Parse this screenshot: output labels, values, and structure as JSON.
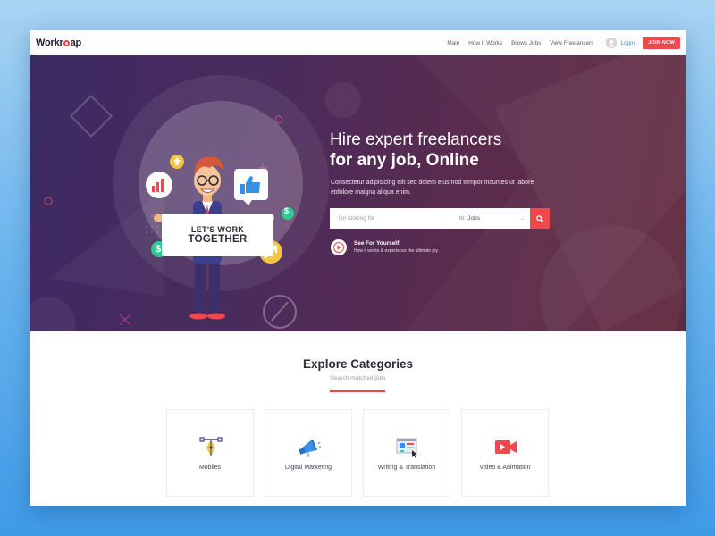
{
  "logo": {
    "text_before": "Workr",
    "text_after": "ap"
  },
  "nav": {
    "items": [
      "Main",
      "How It Works",
      "Brows Jobs",
      "View Freelancers"
    ],
    "login": "Login",
    "join": "JOIN NOW"
  },
  "hero": {
    "title_line1": "Hire expert freelancers",
    "title_line2": "for any job, Online",
    "description": "Consectetur adipisicing elit sed dotem eiusmod tempor incuntes ut labore etdolore maigna aliqua enim.",
    "search_placeholder": "I'm looking for",
    "select_prefix": "In:",
    "select_value": "Jobs",
    "sign_line1": "LET'S WORK",
    "sign_line2": "TOGETHER",
    "video_title": "See For Yourself!",
    "video_subtitle": "How it works & experience the ultimate joy."
  },
  "categories": {
    "title": "Explore Categories",
    "subtitle": "Search matched jobs",
    "items": [
      {
        "label": "Mobiles",
        "icon": "pen-tool-icon"
      },
      {
        "label": "Digital Marketing",
        "icon": "megaphone-icon"
      },
      {
        "label": "Writing & Translation",
        "icon": "document-translate-icon"
      },
      {
        "label": "Video & Animation",
        "icon": "video-camera-icon"
      }
    ]
  },
  "colors": {
    "accent": "#f0484d",
    "link": "#3a8ee3",
    "hero_start": "#3d2a63",
    "hero_end": "#622a3e"
  }
}
